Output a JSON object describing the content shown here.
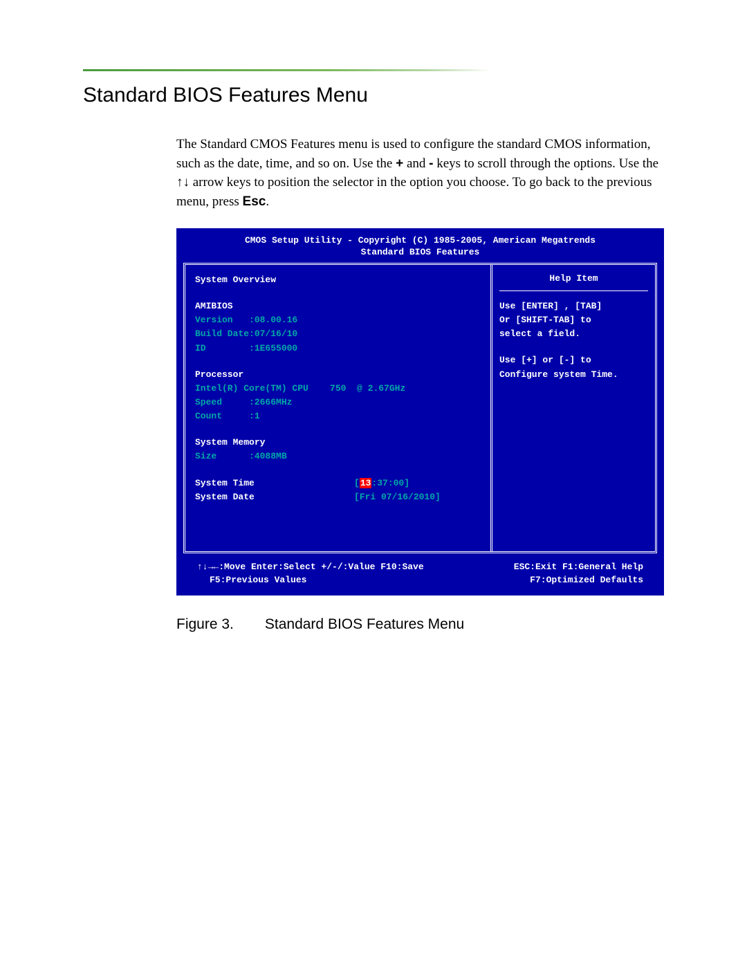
{
  "heading": "Standard BIOS Features Menu",
  "body_text_parts": {
    "p1": "The Standard CMOS Features menu is used to configure the standard CMOS information, such as the date, time, and so on. Use the ",
    "plus": "+",
    "p2": " and ",
    "minus": "-",
    "p3": " keys to scroll through the options. Use the ",
    "arrows": "↑↓",
    "p4": " arrow keys to position the selector in the option you choose. To go back to the previous menu, press ",
    "esc": "Esc",
    "p5": "."
  },
  "bios": {
    "title_line1": "CMOS Setup Utility - Copyright (C) 1985-2005, American Megatrends",
    "title_line2": "Standard BIOS Features",
    "left": {
      "overview_label": "System Overview",
      "amibios_label": "AMIBIOS",
      "version_label": "Version   :",
      "version_value": "08.00.16",
      "build_label": "Build Date:",
      "build_value": "07/16/10",
      "id_label": "ID        :",
      "id_value": "1E655000",
      "processor_label": "Processor",
      "cpu_name_label": "Intel(R) Core(TM) CPU",
      "cpu_name_value": "    750  @ 2.67GHz",
      "speed_label": "Speed     :",
      "speed_value": "2666MHz",
      "count_label": "Count     :",
      "count_value": "1",
      "memory_label": "System Memory",
      "size_label": "Size      :",
      "size_value": "4088MB",
      "systime_label": "System Time",
      "systime_hour": "13",
      "systime_rest": ":37:00]",
      "sysdate_label": "System Date",
      "sysdate_value": "[Fri 07/16/2010]"
    },
    "right": {
      "help_header": "Help Item",
      "line1": "Use [ENTER] , [TAB]",
      "line2": "Or [SHIFT-TAB] to",
      "line3": "select a field.",
      "line4": "Use [+] or [-] to",
      "line5": "Configure system Time."
    },
    "footer": {
      "row1_left": "↑↓→←:Move  Enter:Select  +/-/:Value  F10:Save",
      "row1_right": "ESC:Exit  F1:General Help",
      "row2_left": "F5:Previous Values",
      "row2_right": "F7:Optimized Defaults"
    }
  },
  "figure": {
    "label": "Figure 3.",
    "title": "Standard BIOS Features Menu"
  }
}
